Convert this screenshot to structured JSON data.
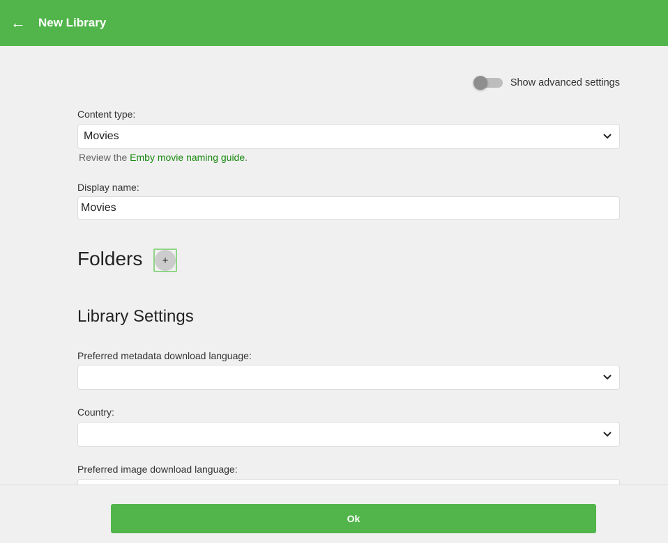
{
  "header": {
    "title": "New Library"
  },
  "advanced": {
    "label": "Show advanced settings",
    "on": false
  },
  "content_type": {
    "label": "Content type:",
    "value": "Movies",
    "help_prefix": "Review the ",
    "help_link": "Emby movie naming guide",
    "help_suffix": "."
  },
  "display_name": {
    "label": "Display name:",
    "value": "Movies"
  },
  "folders": {
    "heading": "Folders",
    "add": "+"
  },
  "library_settings": {
    "heading": "Library Settings",
    "metadata_lang": {
      "label": "Preferred metadata download language:",
      "value": ""
    },
    "country": {
      "label": "Country:",
      "value": ""
    },
    "image_lang": {
      "label": "Preferred image download language:",
      "value": ""
    }
  },
  "footer": {
    "ok": "Ok"
  }
}
